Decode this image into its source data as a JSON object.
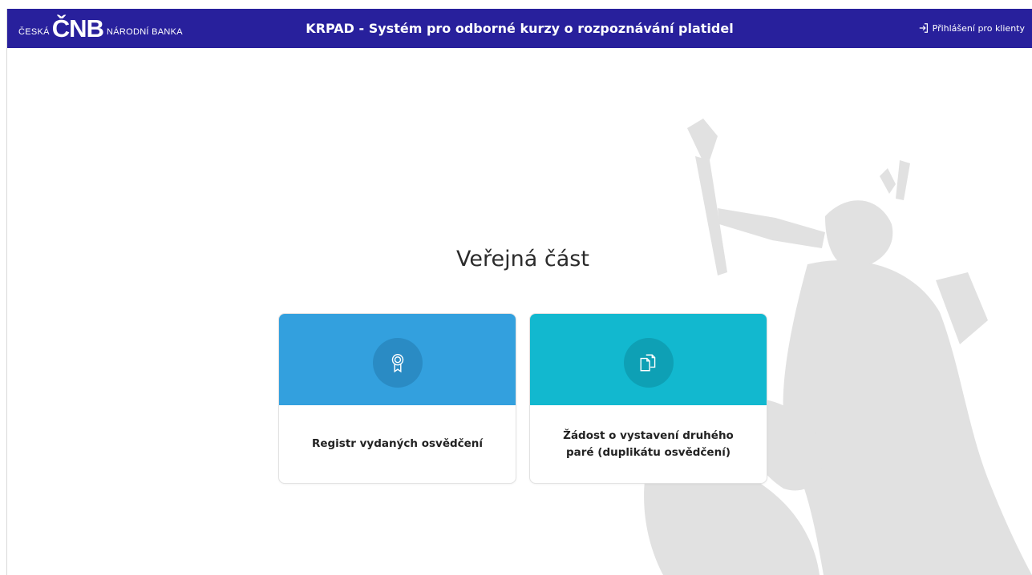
{
  "header": {
    "brand_left": "ČESKÁ",
    "brand_logo": "ČNB",
    "brand_right": "NÁRODNÍ BANKA",
    "title": "KRPAD - Systém pro odborné kurzy o rozpoznávání platidel",
    "login_label": "Přihlášení pro klienty",
    "login_icon": "login-icon",
    "background_color": "#28209c"
  },
  "main": {
    "heading": "Veřejná část",
    "cards": [
      {
        "label": "Registr vydaných osvědčení",
        "icon": "award-icon",
        "color": "#33a0de"
      },
      {
        "label": "Žádost o vystavení druhého paré (duplikátu osvědčení)",
        "icon": "copy-document-icon",
        "color": "#12b8cf"
      }
    ]
  }
}
